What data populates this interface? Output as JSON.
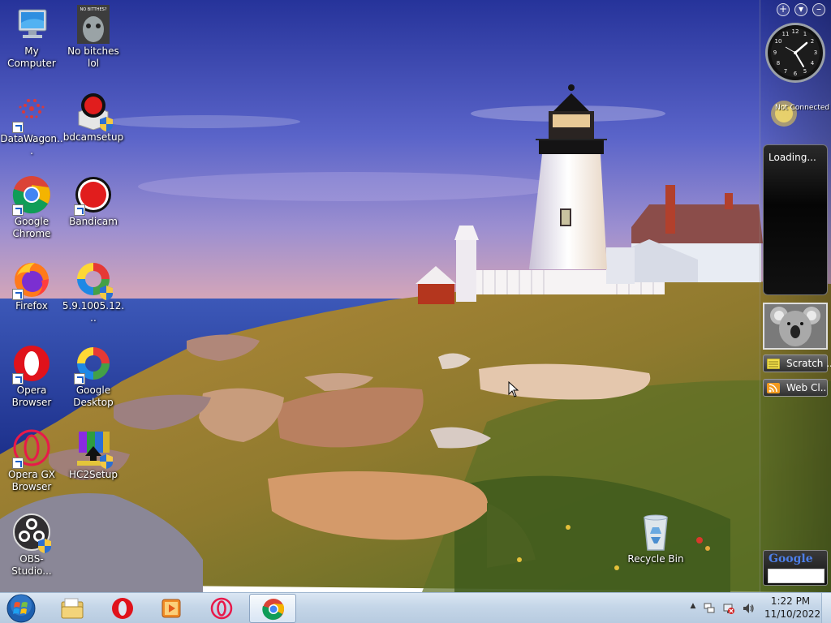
{
  "desktop": {
    "icons": [
      {
        "label": "My\nComputer"
      },
      {
        "label": "No bitches lol"
      },
      {
        "label": "DataWagon..."
      },
      {
        "label": "bdcamsetup"
      },
      {
        "label": "Google\nChrome"
      },
      {
        "label": "Bandicam"
      },
      {
        "label": "Firefox"
      },
      {
        "label": "5.9.1005.12..."
      },
      {
        "label": "Opera\nBrowser"
      },
      {
        "label": "Google\nDesktop"
      },
      {
        "label": "Opera GX\nBrowser"
      },
      {
        "label": "HC2Setup"
      },
      {
        "label": "OBS-Studio..."
      },
      {
        "label": "Recycle Bin"
      }
    ],
    "thumbnail_caption": "NO BITTHES?"
  },
  "sidebar": {
    "controls": [
      "+",
      "▾",
      "–"
    ],
    "weather_status": "Not Connected",
    "feed_status": "Loading...",
    "scratch_label": "Scratch ..",
    "webclip_label": "Web Cl..",
    "google_logo": "Google",
    "clock_numbers": [
      "12",
      "1",
      "2",
      "3",
      "4",
      "5",
      "6",
      "7",
      "8",
      "9",
      "10",
      "11"
    ]
  },
  "taskbar": {
    "time": "1:22 PM",
    "date": "11/10/2022",
    "tray_arrow": "▲"
  },
  "colors": {
    "taskbar_top": "#dbe7f3",
    "taskbar_bottom": "#b7cbe0",
    "sky_top": "#2e3f9e",
    "sea": "#2a47a8"
  }
}
